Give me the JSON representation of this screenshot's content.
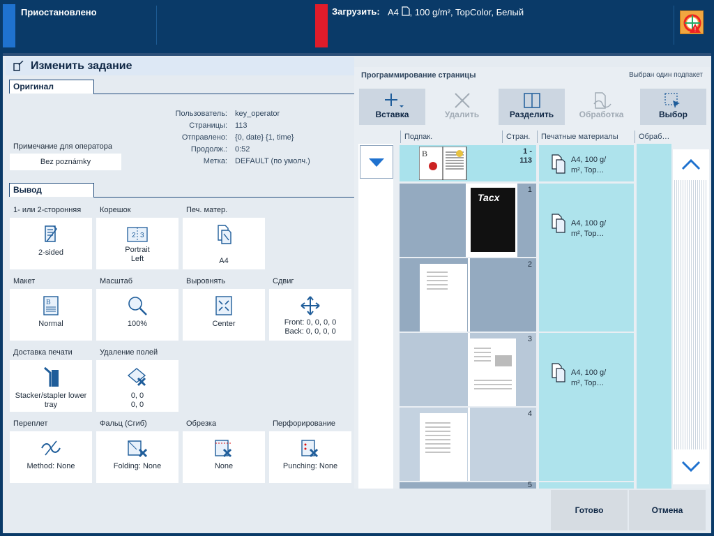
{
  "topbar": {
    "status": "Приостановлено",
    "load_label": "Загрузить:",
    "load_value": "A4",
    "load_detail": ", 100 g/m², TopColor, Белый"
  },
  "header": {
    "title": "Изменить задание"
  },
  "original": {
    "tab": "Оригинал",
    "rows": [
      {
        "label": "Пользователь:",
        "value": "key_operator"
      },
      {
        "label": "Страницы:",
        "value": "113"
      },
      {
        "label": "Отправлено:",
        "value": "{0, date} {1, time}"
      },
      {
        "label": "Продолж.:",
        "value": "0:52"
      },
      {
        "label": "Метка:",
        "value": "DEFAULT (по умолч.)"
      }
    ],
    "note_label": "Примечание для оператора",
    "note_value": "Bez poznámky"
  },
  "output": {
    "tab": "Вывод",
    "tiles": [
      {
        "label": "1- или 2-сторонняя",
        "value": "2-sided",
        "icon": "duplex-icon"
      },
      {
        "label": "Корешок",
        "value": "Portrait\nLeft",
        "value1": "Portrait",
        "value2": "Left",
        "icon": "binding-edge-icon"
      },
      {
        "label": "Печ. матер.",
        "value": "A4",
        "icon": "media-icon"
      },
      {
        "label": "Макет",
        "value": "Normal",
        "icon": "layout-icon"
      },
      {
        "label": "Масштаб",
        "value": "100%",
        "icon": "zoom-icon"
      },
      {
        "label": "Выровнять",
        "value": "Center",
        "icon": "align-icon"
      },
      {
        "label": "Сдвиг",
        "value1": "Front: 0, 0, 0, 0",
        "value2": "Back: 0, 0, 0, 0",
        "icon": "shift-icon"
      },
      {
        "label": "Доставка печати",
        "value1": "Stacker/stapler lower",
        "value2": "tray",
        "icon": "output-tray-icon"
      },
      {
        "label": "Удаление полей",
        "value1": "0, 0",
        "value2": "0, 0",
        "icon": "edge-delete-icon"
      },
      {
        "label": "Переплет",
        "value": "Method: None",
        "icon": "binding-icon"
      },
      {
        "label": "Фальц (Сгиб)",
        "value": "Folding: None",
        "icon": "folding-icon"
      },
      {
        "label": "Обрезка",
        "value": "None",
        "icon": "trimming-icon"
      },
      {
        "label": "Перфорирование",
        "value": "Punching: None",
        "icon": "punching-icon"
      }
    ]
  },
  "page_programming": {
    "title": "Программирование страницы",
    "selection": "Выбран один подпакет",
    "tools": {
      "insert": "Вставка",
      "delete": "Удалить",
      "split": "Разделить",
      "process": "Обработка",
      "select": "Выбор"
    },
    "columns": {
      "subset": "Подпак.",
      "pages": "Стран.",
      "media": "Печатные материалы",
      "finishing": "Обраб…"
    },
    "selected_range": "1 -",
    "selected_range2": "113",
    "pages": [
      "1",
      "2",
      "3",
      "4",
      "5"
    ],
    "media_text1": "A4",
    "media_text2": ", 100 g/",
    "media_text3": "m², Top…",
    "cover_text": "Tacx"
  },
  "buttons": {
    "done": "Готово",
    "cancel": "Отмена"
  },
  "colors": {
    "accent": "#0a3a68",
    "selected": "#a9e2ec",
    "status_blue": "#1f72cf",
    "status_red": "#e01c2a"
  }
}
